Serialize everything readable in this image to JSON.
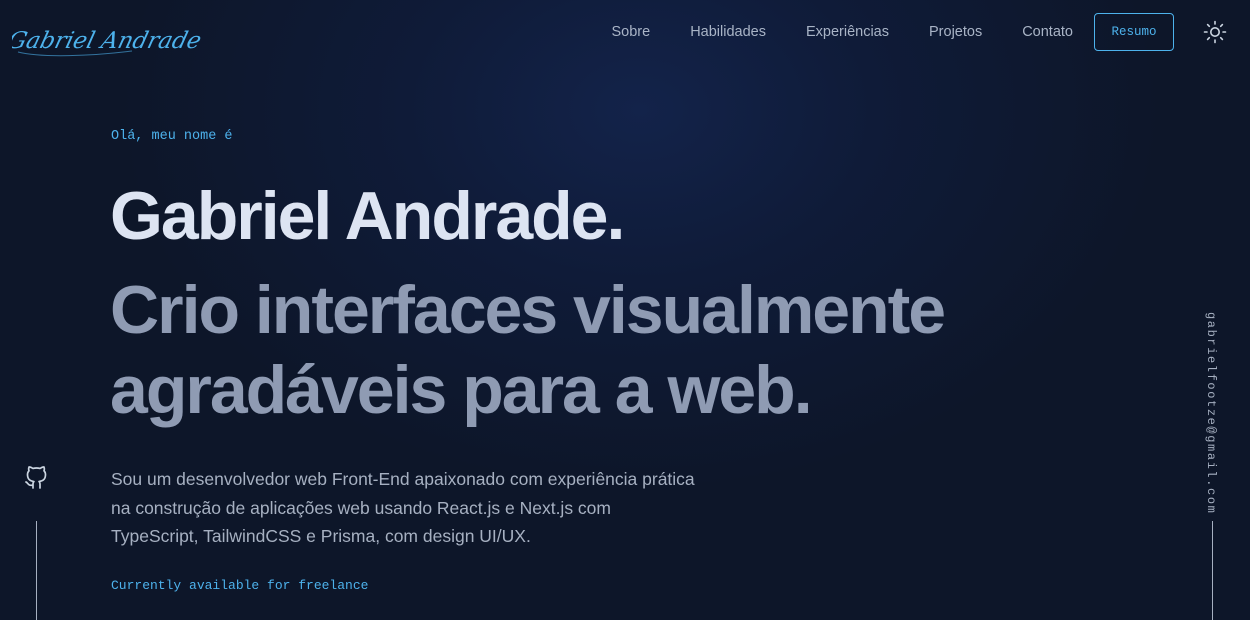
{
  "brand": {
    "signature": "Gabriel Andrade"
  },
  "nav": {
    "links": [
      "Sobre",
      "Habilidades",
      "Experiências",
      "Projetos",
      "Contato"
    ],
    "resume_label": "Resumo",
    "theme_icon": "sun-icon"
  },
  "hero": {
    "intro": "Olá, meu nome é",
    "name": "Gabriel Andrade.",
    "tagline": "Crio interfaces visualmente agradáveis para a web.",
    "bio": "Sou um desenvolvedor web Front-End apaixonado com experiência prática na construção de aplicações web usando React.js e Next.js com TypeScript, TailwindCSS e Prisma, com design UI/UX.",
    "availability": "Currently available for freelance"
  },
  "sidebar_left": {
    "icons": [
      "github-icon"
    ]
  },
  "sidebar_right": {
    "email": "gabrielfootze@gmail.com"
  },
  "colors": {
    "background": "#0d1629",
    "accent": "#4db2ec",
    "heading": "#dde4f2",
    "subheading": "#8f9bb3",
    "text": "#a6b0c1"
  }
}
